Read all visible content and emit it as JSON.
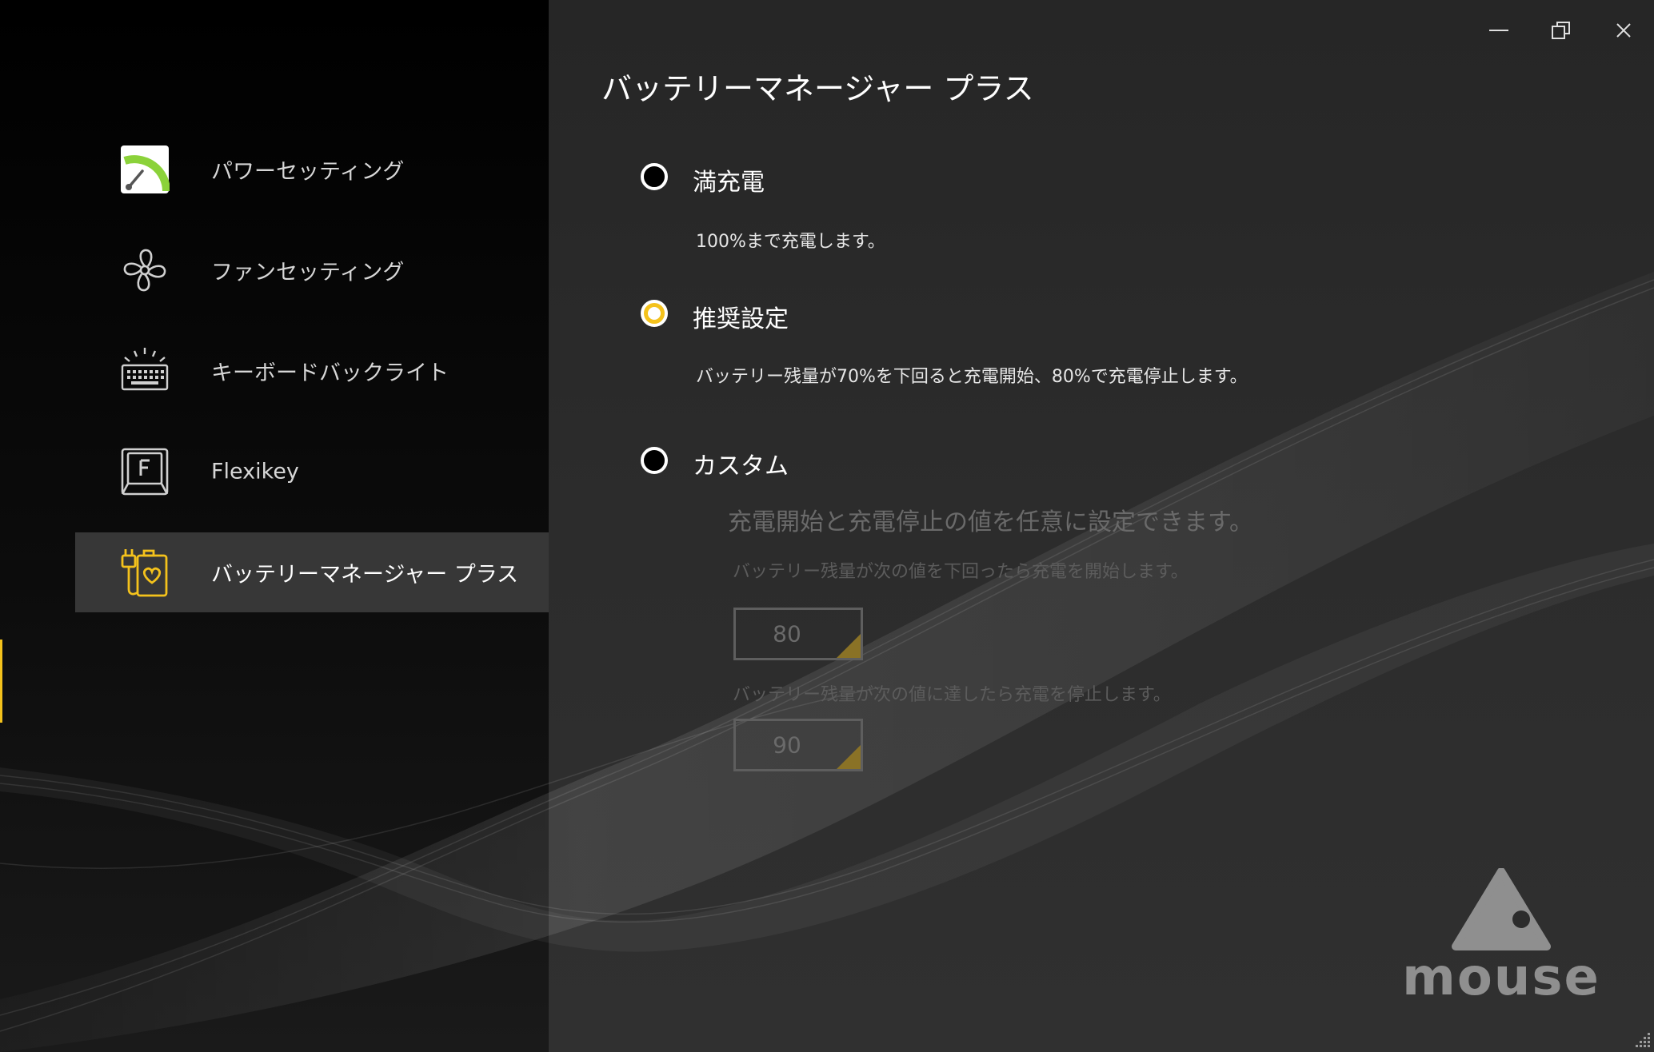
{
  "sidebar": {
    "items": [
      {
        "label": "パワーセッティング",
        "icon": "power-gauge-icon",
        "active": false
      },
      {
        "label": "ファンセッティング",
        "icon": "fan-icon",
        "active": false
      },
      {
        "label": "キーボードバックライト",
        "icon": "keyboard-backlight-icon",
        "active": false
      },
      {
        "label": "Flexikey",
        "icon": "flexikey-icon",
        "active": false
      },
      {
        "label": "バッテリーマネージャー プラス",
        "icon": "battery-plug-icon",
        "active": true
      }
    ]
  },
  "window": {
    "minimize_icon": "minimize-icon",
    "restore_icon": "restore-icon",
    "close_icon": "close-icon"
  },
  "main": {
    "title": "バッテリーマネージャー プラス",
    "options": [
      {
        "label": "満充電",
        "description": "100%まで充電します。",
        "selected": false
      },
      {
        "label": "推奨設定",
        "description": "バッテリー残量が70%を下回ると充電開始、80%で充電停止します。",
        "selected": true
      },
      {
        "label": "カスタム",
        "selected": false
      }
    ],
    "custom": {
      "heading": "充電開始と充電停止の値を任意に設定できます。",
      "start_label": "バッテリー残量が次の値を下回ったら充電を開始します。",
      "start_value": "80",
      "stop_label": "バッテリー残量が次の値に達したら充電を停止します。",
      "stop_value": "90"
    }
  },
  "branding": {
    "logo_text": "mouse"
  },
  "colors": {
    "accent": "#f4c21c",
    "gauge_green": "#8bd23a",
    "sidebar_bg": "#0d0d0d",
    "content_bg": "#2b2b2b"
  }
}
